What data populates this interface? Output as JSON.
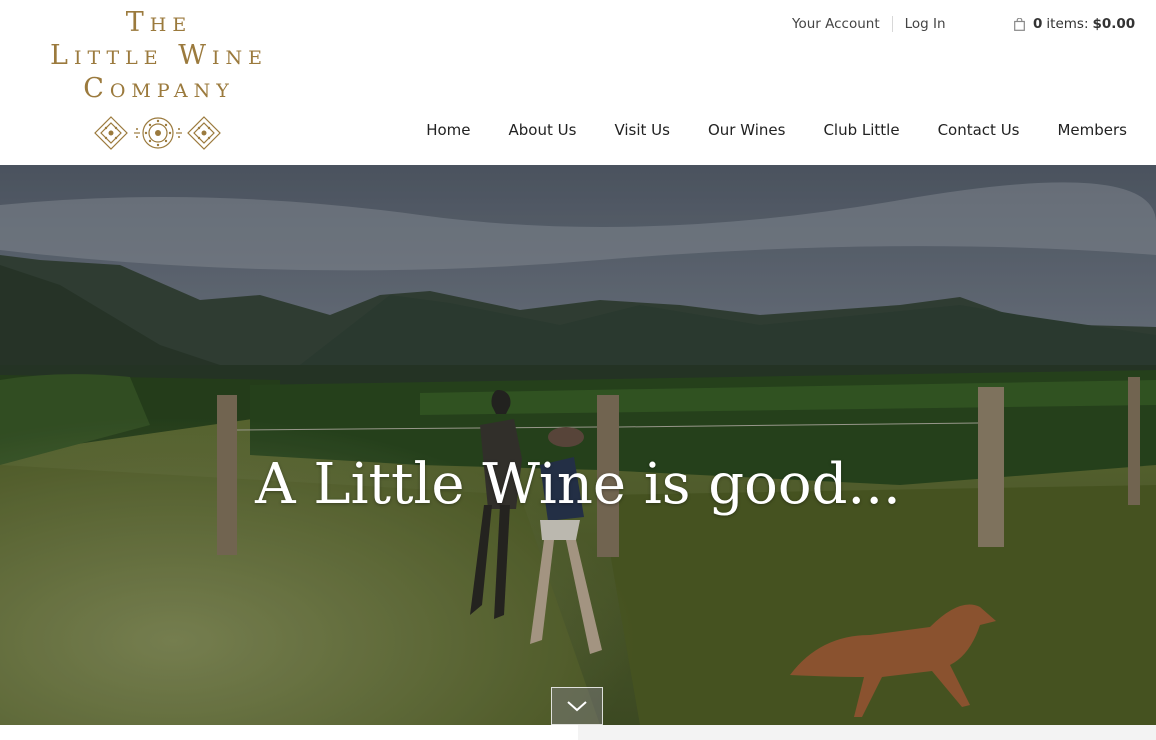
{
  "logo": {
    "line1": "The",
    "line2": "Little Wine",
    "line3": "Company"
  },
  "top_links": [
    "Your Account",
    "Log In"
  ],
  "cart": {
    "count": "0",
    "items_label": "items:",
    "total": "$0.00"
  },
  "nav": [
    "Home",
    "About Us",
    "Visit Us",
    "Our Wines",
    "Club Little",
    "Contact Us",
    "Members"
  ],
  "hero": {
    "title": "A Little Wine is good..."
  },
  "icons": {
    "cart": "shopping-bag-icon",
    "scroll": "chevron-down-icon",
    "emblem": "diamond-pattern-icon"
  },
  "colors": {
    "brand_gold": "#9b7a3d",
    "nav_text": "#222222"
  }
}
